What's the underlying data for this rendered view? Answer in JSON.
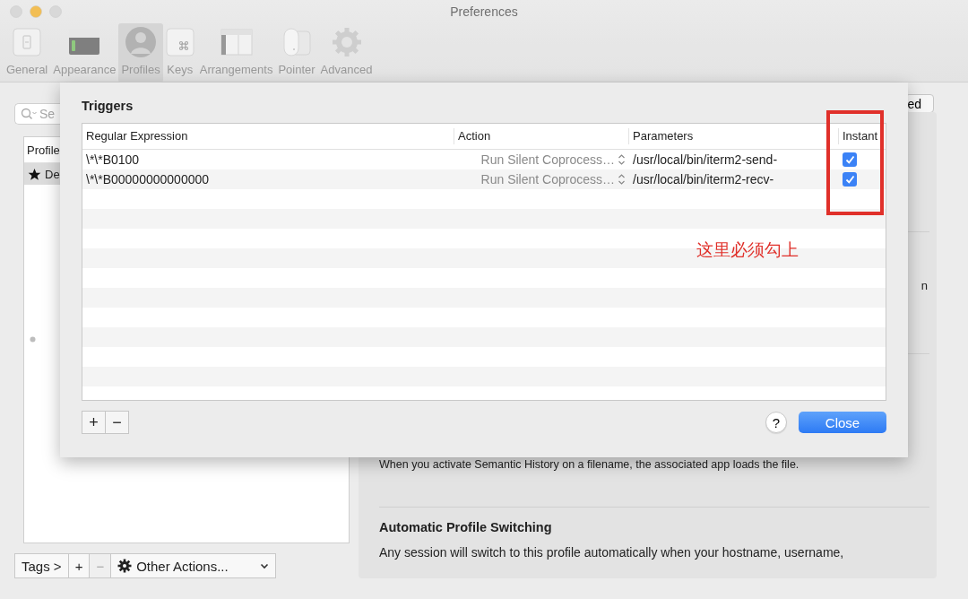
{
  "window": {
    "title": "Preferences"
  },
  "toolbar": {
    "tabs": [
      {
        "label": "General",
        "selected": false
      },
      {
        "label": "Appearance",
        "selected": false
      },
      {
        "label": "Profiles",
        "selected": true
      },
      {
        "label": "Keys",
        "selected": false
      },
      {
        "label": "Arrangements",
        "selected": false
      },
      {
        "label": "Pointer",
        "selected": false
      },
      {
        "label": "Advanced",
        "selected": false
      }
    ]
  },
  "sidebar": {
    "search": {
      "placeholder": "Se"
    },
    "list": {
      "column": "Profile",
      "rows": [
        {
          "label": "De",
          "default": true,
          "selected": true
        }
      ]
    },
    "tags": "Tags >",
    "add": "+",
    "remove": {
      "label": "−",
      "disabled": true
    },
    "other_actions": "Other Actions..."
  },
  "panel": {
    "button": "ed",
    "fragment": "n",
    "note": "When you activate Semantic History on a filename, the associated app loads the file.",
    "section": {
      "title": "Automatic Profile Switching",
      "text": "Any session will switch to this profile automatically when your hostname, username,"
    }
  },
  "sheet": {
    "title": "Triggers",
    "columns": [
      "Regular Expression",
      "Action",
      "Parameters",
      "Instant"
    ],
    "rows": [
      {
        "regex": "\\*\\*B0100",
        "action": "Run Silent Coprocess…",
        "parameters": "/usr/local/bin/iterm2-send-",
        "instant": true
      },
      {
        "regex": "\\*\\*B00000000000000",
        "action": "Run Silent Coprocess…",
        "parameters": "/usr/local/bin/iterm2-recv-",
        "instant": true
      }
    ],
    "add": "+",
    "remove": "−",
    "help": "?",
    "close": "Close"
  },
  "annotation": {
    "text": "这里必须勾上"
  }
}
